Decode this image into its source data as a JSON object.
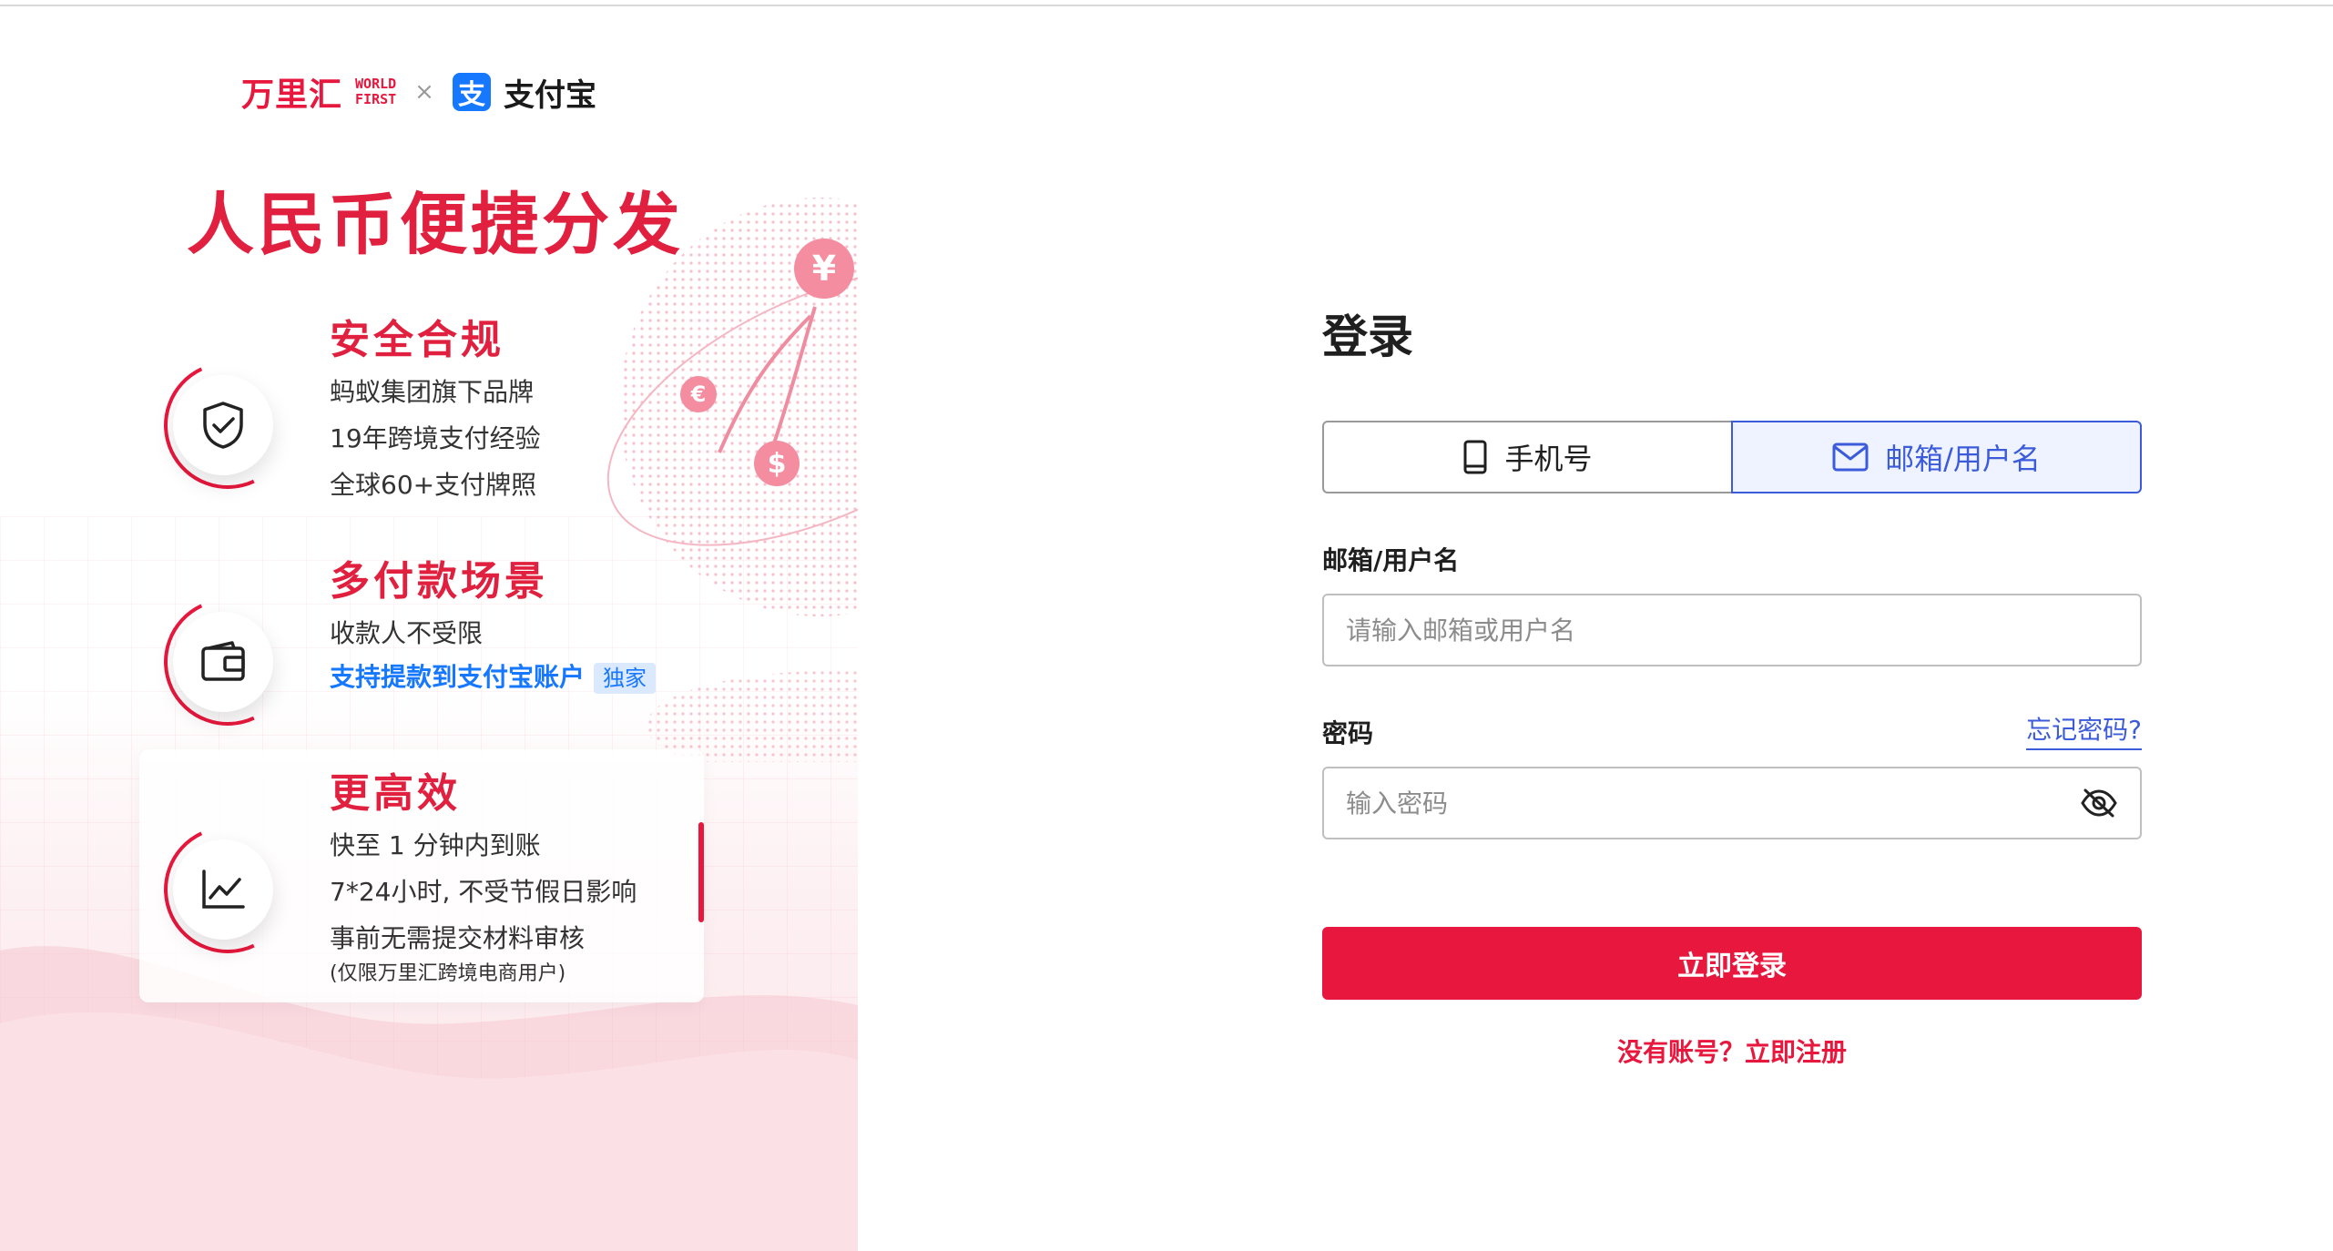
{
  "brand": {
    "worldfirst_cn": "万里汇",
    "worldfirst_en_line1": "WORLD",
    "worldfirst_en_line2": "FIRST",
    "separator": "×",
    "alipay_icon_char": "支",
    "alipay_name": "支付宝"
  },
  "hero": {
    "title": "人民币便捷分发"
  },
  "features": [
    {
      "title": "安全合规",
      "icon": "shield-check-icon",
      "lines": [
        "蚂蚁集团旗下品牌",
        "19年跨境支付经验",
        "全球60+支付牌照"
      ]
    },
    {
      "title": "多付款场景",
      "icon": "wallet-icon",
      "lines": [
        "收款人不受限"
      ],
      "link": "支持提款到支付宝账户",
      "tag": "独家"
    },
    {
      "title": "更高效",
      "icon": "trend-chart-icon",
      "lines": [
        "快至 1 分钟内到账",
        "7*24小时, 不受节假日影响",
        "事前无需提交材料审核"
      ],
      "note": "(仅限万里汇跨境电商用户)"
    }
  ],
  "decor": {
    "yuan": "¥",
    "euro": "€",
    "dollar": "$"
  },
  "login": {
    "title": "登录",
    "tabs": [
      {
        "label": "手机号",
        "icon": "phone-icon"
      },
      {
        "label": "邮箱/用户名",
        "icon": "mail-icon"
      }
    ],
    "active_tab": "邮箱/用户名",
    "username_label": "邮箱/用户名",
    "username_placeholder": "请输入邮箱或用户名",
    "username_value": "",
    "password_label": "密码",
    "forgot_label": "忘记密码?",
    "password_placeholder": "输入密码",
    "password_value": "",
    "submit_label": "立即登录",
    "register_label": "没有账号？立即注册"
  },
  "colors": {
    "brand_red": "#e8173d",
    "accent_blue": "#3b5bdb",
    "alipay_blue": "#1677ff"
  }
}
